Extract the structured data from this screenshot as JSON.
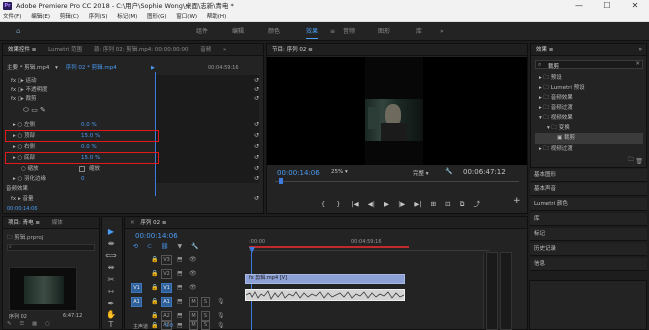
{
  "window": {
    "app_icon": "Pr",
    "title": "Adobe Premiere Pro CC 2018 - C:\\用户\\Sophie Wong\\桌面\\志新\\青电 *",
    "minimize": "—",
    "maximize": "☐",
    "close": "✕"
  },
  "menu": [
    "文件(F)",
    "编辑(E)",
    "剪辑(C)",
    "序列(S)",
    "标记(M)",
    "图形(G)",
    "窗口(W)",
    "帮助(H)"
  ],
  "workspaces": [
    "组件",
    "编辑",
    "颜色",
    "效果",
    "音频",
    "图形",
    "库"
  ],
  "workspace_more": "»",
  "effect_controls": {
    "tabs": [
      "效果控件 ≡",
      "Lumetri 范围",
      "源: 序列 02: 剪辑.mp4: 00:00:00:00",
      "音频"
    ],
    "tab_more": "»",
    "master_label": "主要 * 剪辑.mp4",
    "sequence_label": "序列 02 * 剪辑.mp4",
    "time_start": "▶",
    "time_end": "00:04:59:16",
    "rows": [
      {
        "label": "fx  ▯▸ 运动",
        "value": ""
      },
      {
        "label": "fx  ▯▸ 不透明度",
        "value": ""
      },
      {
        "label": "fx  ▯▸ 裁剪",
        "value": ""
      },
      {
        "label": "⬭  ▭  ✎",
        "value": ""
      },
      {
        "label": "▸ ○ 左侧",
        "value": "0.0 %"
      },
      {
        "label": "▸ ○ 顶部",
        "value": "15.0 %"
      },
      {
        "label": "▸ ○ 右侧",
        "value": "0.0 %"
      },
      {
        "label": "▸ ○ 底部",
        "value": "15.0 %"
      },
      {
        "label": "○ 缩放",
        "value": ""
      },
      {
        "label": "▸ ○ 羽化边缘",
        "value": "0"
      }
    ],
    "zoom_checkbox_label": "缩放",
    "audio_effects": "音频效果",
    "volume_row": "fx ▸ 音量",
    "timecode": "00:00:14:06",
    "reset_icon": "↺"
  },
  "program": {
    "tab": "节目: 序列 02 ≡",
    "timecode": "00:00:14:06",
    "zoom": "25%",
    "quality": "完整",
    "duration": "00:06:47:12",
    "transport": [
      "{",
      "}",
      "|◀",
      "◀|",
      "▶",
      "|▶",
      "▶|",
      "⊞",
      "⊡",
      "⧉",
      "⤴",
      "📷"
    ],
    "add": "+",
    "settings": "🔧"
  },
  "effects": {
    "title": "效果 ≡",
    "more": "»",
    "search_value": "裁剪",
    "tree": [
      {
        "label": "▸ 🗀 预设",
        "indent": 0
      },
      {
        "label": "▸ 🗀 Lumetri 预设",
        "indent": 0
      },
      {
        "label": "▸ 🗀 音频效果",
        "indent": 0
      },
      {
        "label": "▸ 🗀 音频过渡",
        "indent": 0
      },
      {
        "label": "▾ 🗀 视频效果",
        "indent": 0
      },
      {
        "label": "▾ 🗀 变换",
        "indent": 1
      },
      {
        "label": "▣ 裁剪",
        "indent": 2
      },
      {
        "label": "▸ 🗀 视频过渡",
        "indent": 0
      }
    ],
    "collapsed_panels": [
      "基本图形",
      "基本声音",
      "Lumetri 颜色",
      "库",
      "标记",
      "历史记录",
      "信息"
    ]
  },
  "project": {
    "tabs": [
      "项目: 青电 ≡",
      "媒体"
    ],
    "file_name": "剪辑.prproj",
    "thumb_label": "序列 02",
    "thumb_duration": "6:47:12",
    "footer_icons": [
      "✎",
      "☰",
      "▦",
      "○"
    ]
  },
  "timeline": {
    "tab_close": "✕",
    "tab": "序列 02 ≡",
    "timecode": "00:00:14:06",
    "ruler": [
      ":00:00",
      "00:04:59:16"
    ],
    "video_tracks": [
      "V3",
      "V2",
      "V1"
    ],
    "audio_tracks": [
      "A1",
      "A2",
      "A3"
    ],
    "clip_label": "fx 剪辑.mp4 [V]",
    "master": "主声道",
    "master_value": "0.0",
    "mute": "M",
    "solo": "S"
  },
  "tools": [
    "▶",
    "⇼",
    "⟺",
    "⇹",
    "✂",
    "⇿",
    "✒",
    "✋",
    "T"
  ],
  "colors": {
    "accent": "#4b9cf5",
    "highlight_box": "#e0191c",
    "playhead": "#3d7be0"
  }
}
